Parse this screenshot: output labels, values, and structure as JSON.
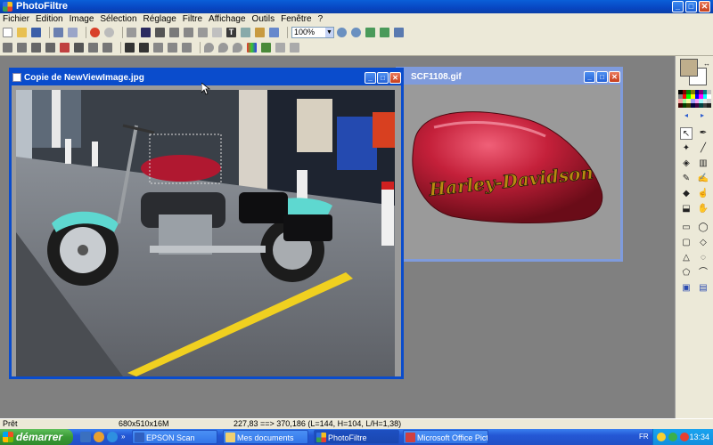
{
  "app": {
    "title": "PhotoFiltre"
  },
  "menu": [
    "Fichier",
    "Edition",
    "Image",
    "Sélection",
    "Réglage",
    "Filtre",
    "Affichage",
    "Outils",
    "Fenêtre",
    "?"
  ],
  "toolbar": {
    "zoom_value": "100%"
  },
  "windows": {
    "front": {
      "title": "Copie de NewViewImage.jpg"
    },
    "back": {
      "title": "SCF1108.gif"
    }
  },
  "image_text": {
    "tank_logo": "Harley-Davidson"
  },
  "status": {
    "ready": "Prêt",
    "size": "680x510x16M",
    "coords": "227,83 ==> 370,186 (L=144, H=104, L/H=1,38)"
  },
  "taskbar": {
    "start": "démarrer",
    "tasks": [
      "EPSON Scan",
      "Mes documents",
      "PhotoFiltre",
      "Microsoft Office Pictu..."
    ],
    "lang": "FR",
    "clock": "13:34"
  },
  "colors": {
    "title_blue": "#0846c2",
    "foreground_color": "#bfae8c",
    "background_color": "#ffffff",
    "tank_red": "#c4203a"
  }
}
